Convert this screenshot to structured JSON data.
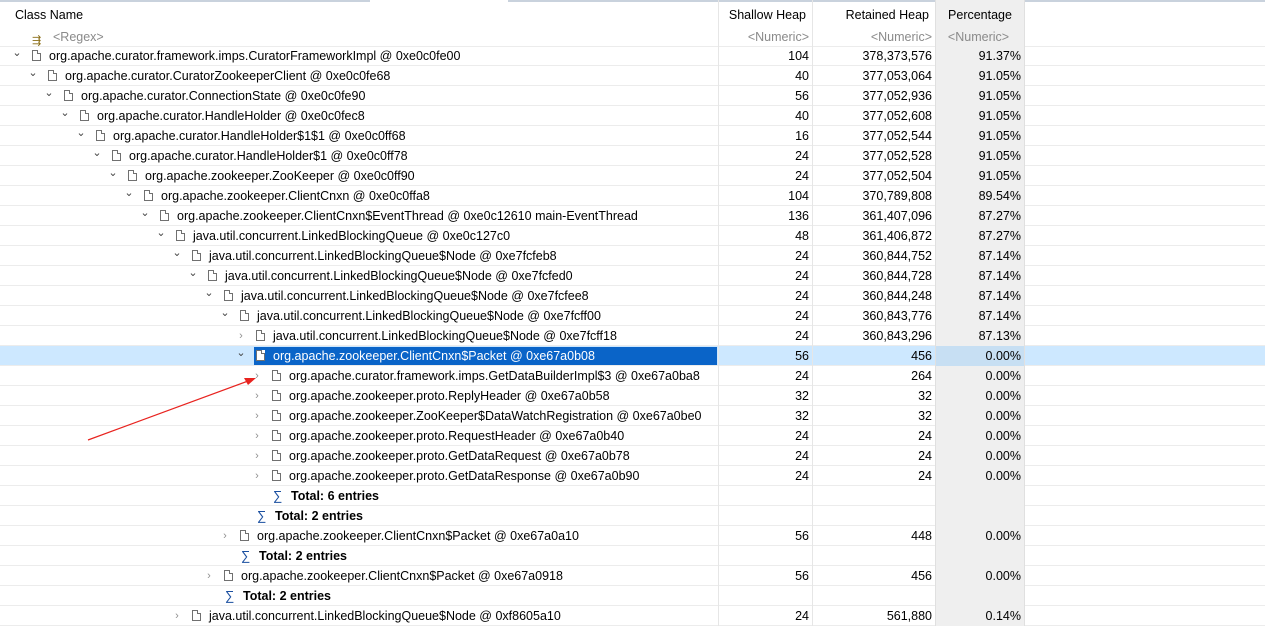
{
  "columns": {
    "name": "Class Name",
    "shallow": "Shallow Heap",
    "retained": "Retained Heap",
    "percentage": "Percentage"
  },
  "filters": {
    "name": "<Regex>",
    "shallow": "<Numeric>",
    "retained": "<Numeric>",
    "percentage": "<Numeric>"
  },
  "icons": {
    "filter": "regex-filter-icon",
    "object": "object-file-icon",
    "expand": "chevron-down-icon",
    "collapse": "chevron-right-icon",
    "total": "sigma-icon"
  },
  "colors": {
    "selection": "#0a64c8",
    "selected_row": "#cde8ff",
    "percentage_column": "#efefef",
    "annotation_arrow": "#e8231f"
  },
  "rows": [
    {
      "kind": "node",
      "depth": 0,
      "toggle": "expanded",
      "name": "org.apache.curator.framework.imps.CuratorFrameworkImpl @ 0xe0c0fe00",
      "shallow": "104",
      "retained": "378,373,576",
      "pct": "91.37%"
    },
    {
      "kind": "node",
      "depth": 1,
      "toggle": "expanded",
      "name": "org.apache.curator.CuratorZookeeperClient @ 0xe0c0fe68",
      "shallow": "40",
      "retained": "377,053,064",
      "pct": "91.05%"
    },
    {
      "kind": "node",
      "depth": 2,
      "toggle": "expanded",
      "name": "org.apache.curator.ConnectionState @ 0xe0c0fe90",
      "shallow": "56",
      "retained": "377,052,936",
      "pct": "91.05%"
    },
    {
      "kind": "node",
      "depth": 3,
      "toggle": "expanded",
      "name": "org.apache.curator.HandleHolder @ 0xe0c0fec8",
      "shallow": "40",
      "retained": "377,052,608",
      "pct": "91.05%"
    },
    {
      "kind": "node",
      "depth": 4,
      "toggle": "expanded",
      "name": "org.apache.curator.HandleHolder$1$1 @ 0xe0c0ff68",
      "shallow": "16",
      "retained": "377,052,544",
      "pct": "91.05%"
    },
    {
      "kind": "node",
      "depth": 5,
      "toggle": "expanded",
      "name": "org.apache.curator.HandleHolder$1 @ 0xe0c0ff78",
      "shallow": "24",
      "retained": "377,052,528",
      "pct": "91.05%"
    },
    {
      "kind": "node",
      "depth": 6,
      "toggle": "expanded",
      "name": "org.apache.zookeeper.ZooKeeper @ 0xe0c0ff90",
      "shallow": "24",
      "retained": "377,052,504",
      "pct": "91.05%"
    },
    {
      "kind": "node",
      "depth": 7,
      "toggle": "expanded",
      "name": "org.apache.zookeeper.ClientCnxn @ 0xe0c0ffa8",
      "shallow": "104",
      "retained": "370,789,808",
      "pct": "89.54%"
    },
    {
      "kind": "node",
      "depth": 8,
      "toggle": "expanded",
      "name": "org.apache.zookeeper.ClientCnxn$EventThread @ 0xe0c12610  main-EventThread",
      "shallow": "136",
      "retained": "361,407,096",
      "pct": "87.27%"
    },
    {
      "kind": "node",
      "depth": 9,
      "toggle": "expanded",
      "name": "java.util.concurrent.LinkedBlockingQueue @ 0xe0c127c0",
      "shallow": "48",
      "retained": "361,406,872",
      "pct": "87.27%"
    },
    {
      "kind": "node",
      "depth": 10,
      "toggle": "expanded",
      "name": "java.util.concurrent.LinkedBlockingQueue$Node @ 0xe7fcfeb8",
      "shallow": "24",
      "retained": "360,844,752",
      "pct": "87.14%"
    },
    {
      "kind": "node",
      "depth": 11,
      "toggle": "expanded",
      "name": "java.util.concurrent.LinkedBlockingQueue$Node @ 0xe7fcfed0",
      "shallow": "24",
      "retained": "360,844,728",
      "pct": "87.14%"
    },
    {
      "kind": "node",
      "depth": 12,
      "toggle": "expanded",
      "name": "java.util.concurrent.LinkedBlockingQueue$Node @ 0xe7fcfee8",
      "shallow": "24",
      "retained": "360,844,248",
      "pct": "87.14%"
    },
    {
      "kind": "node",
      "depth": 13,
      "toggle": "expanded",
      "name": "java.util.concurrent.LinkedBlockingQueue$Node @ 0xe7fcff00",
      "shallow": "24",
      "retained": "360,843,776",
      "pct": "87.14%"
    },
    {
      "kind": "node",
      "depth": 14,
      "toggle": "collapsed",
      "name": "java.util.concurrent.LinkedBlockingQueue$Node @ 0xe7fcff18",
      "shallow": "24",
      "retained": "360,843,296",
      "pct": "87.13%"
    },
    {
      "kind": "node",
      "depth": 14,
      "toggle": "expanded",
      "selected": true,
      "name": "org.apache.zookeeper.ClientCnxn$Packet @ 0xe67a0b08",
      "shallow": "56",
      "retained": "456",
      "pct": "0.00%"
    },
    {
      "kind": "node",
      "depth": 15,
      "toggle": "collapsed",
      "name": "org.apache.curator.framework.imps.GetDataBuilderImpl$3 @ 0xe67a0ba8",
      "shallow": "24",
      "retained": "264",
      "pct": "0.00%"
    },
    {
      "kind": "node",
      "depth": 15,
      "toggle": "collapsed",
      "name": "org.apache.zookeeper.proto.ReplyHeader @ 0xe67a0b58",
      "shallow": "32",
      "retained": "32",
      "pct": "0.00%"
    },
    {
      "kind": "node",
      "depth": 15,
      "toggle": "collapsed",
      "name": "org.apache.zookeeper.ZooKeeper$DataWatchRegistration @ 0xe67a0be0",
      "shallow": "32",
      "retained": "32",
      "pct": "0.00%"
    },
    {
      "kind": "node",
      "depth": 15,
      "toggle": "collapsed",
      "name": "org.apache.zookeeper.proto.RequestHeader @ 0xe67a0b40",
      "shallow": "24",
      "retained": "24",
      "pct": "0.00%"
    },
    {
      "kind": "node",
      "depth": 15,
      "toggle": "collapsed",
      "name": "org.apache.zookeeper.proto.GetDataRequest @ 0xe67a0b78",
      "shallow": "24",
      "retained": "24",
      "pct": "0.00%"
    },
    {
      "kind": "node",
      "depth": 15,
      "toggle": "collapsed",
      "name": "org.apache.zookeeper.proto.GetDataResponse @ 0xe67a0b90",
      "shallow": "24",
      "retained": "24",
      "pct": "0.00%"
    },
    {
      "kind": "total",
      "depth": 15,
      "name": "Total: 6 entries"
    },
    {
      "kind": "total",
      "depth": 14,
      "name": "Total: 2 entries"
    },
    {
      "kind": "node",
      "depth": 13,
      "toggle": "collapsed",
      "name": "org.apache.zookeeper.ClientCnxn$Packet @ 0xe67a0a10",
      "shallow": "56",
      "retained": "448",
      "pct": "0.00%"
    },
    {
      "kind": "total",
      "depth": 13,
      "name": "Total: 2 entries"
    },
    {
      "kind": "node",
      "depth": 12,
      "toggle": "collapsed",
      "name": "org.apache.zookeeper.ClientCnxn$Packet @ 0xe67a0918",
      "shallow": "56",
      "retained": "456",
      "pct": "0.00%"
    },
    {
      "kind": "total",
      "depth": 12,
      "name": "Total: 2 entries"
    },
    {
      "kind": "node",
      "depth": 10,
      "toggle": "collapsed",
      "name": "java.util.concurrent.LinkedBlockingQueue$Node @ 0xf8605a10",
      "shallow": "24",
      "retained": "561,880",
      "pct": "0.14%"
    }
  ]
}
